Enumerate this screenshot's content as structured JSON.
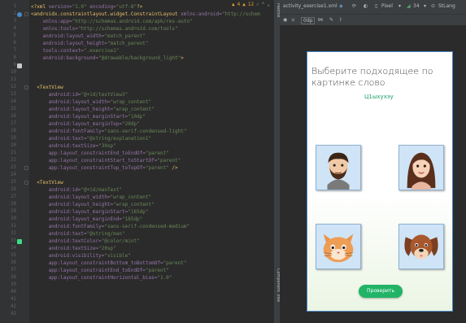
{
  "editor": {
    "status": {
      "warnings": "4",
      "weak_warnings": "12",
      "check_glyph": "✓"
    },
    "line_numbers": [
      "1",
      "2",
      "3",
      "4",
      "5",
      "6",
      "7",
      "8",
      "9",
      "10",
      "11",
      "12",
      "13",
      "14",
      "15",
      "16",
      "17",
      "18",
      "19",
      "20",
      "21",
      "22",
      "23",
      "24",
      "25",
      "26",
      "27",
      "28",
      "29",
      "30",
      "31",
      "32",
      "33",
      "34",
      "35",
      "36",
      "37",
      "38",
      "39",
      "40",
      "41",
      "42",
      "43"
    ],
    "lines": [
      [
        {
          "c": "tg",
          "t": "<?xml "
        },
        {
          "c": "at",
          "t": "version="
        },
        {
          "c": "sv",
          "t": "\"1.0\" "
        },
        {
          "c": "at",
          "t": "encoding="
        },
        {
          "c": "sv",
          "t": "\"utf-8\""
        },
        {
          "c": "tg",
          "t": "?>"
        }
      ],
      [
        {
          "c": "tg",
          "t": "<androidx.constraintlayout.widget.ConstraintLayout "
        },
        {
          "c": "at",
          "t": "xmlns:android="
        },
        {
          "c": "sv",
          "t": "\"http://schem"
        }
      ],
      [
        {
          "c": "pl",
          "t": "    "
        },
        {
          "c": "at",
          "t": "xmlns:app="
        },
        {
          "c": "sv",
          "t": "\"http://schemas.android.com/apk/res-auto\""
        }
      ],
      [
        {
          "c": "pl",
          "t": "    "
        },
        {
          "c": "at",
          "t": "xmlns:tools="
        },
        {
          "c": "sv",
          "t": "\"http://schemas.android.com/tools\""
        }
      ],
      [
        {
          "c": "pl",
          "t": "    "
        },
        {
          "c": "at",
          "t": "android:layout_width="
        },
        {
          "c": "sv",
          "t": "\"match_parent\""
        }
      ],
      [
        {
          "c": "pl",
          "t": "    "
        },
        {
          "c": "at",
          "t": "android:layout_height="
        },
        {
          "c": "sv",
          "t": "\"match_parent\""
        }
      ],
      [
        {
          "c": "pl",
          "t": "    "
        },
        {
          "c": "at",
          "t": "tools:context="
        },
        {
          "c": "sv",
          "t": "\".exercise1\""
        }
      ],
      [
        {
          "c": "pl",
          "t": "    "
        },
        {
          "c": "at",
          "t": "android:background="
        },
        {
          "c": "sv",
          "t": "\"@drawable/background_light\""
        },
        {
          "c": "tg",
          "t": ">"
        }
      ],
      [],
      [],
      [],
      [
        {
          "c": "pl",
          "t": "  "
        },
        {
          "c": "tg",
          "t": "<TextView"
        }
      ],
      [
        {
          "c": "pl",
          "t": "      "
        },
        {
          "c": "at",
          "t": "android:id="
        },
        {
          "c": "sv",
          "t": "\"@+id/textView3\""
        }
      ],
      [
        {
          "c": "pl",
          "t": "      "
        },
        {
          "c": "at",
          "t": "android:layout_width="
        },
        {
          "c": "sv",
          "t": "\"wrap_content\""
        }
      ],
      [
        {
          "c": "pl",
          "t": "      "
        },
        {
          "c": "at",
          "t": "android:layout_height="
        },
        {
          "c": "sv",
          "t": "\"wrap_content\""
        }
      ],
      [
        {
          "c": "pl",
          "t": "      "
        },
        {
          "c": "at",
          "t": "android:layout_marginStart="
        },
        {
          "c": "sv",
          "t": "\"10dp\""
        }
      ],
      [
        {
          "c": "pl",
          "t": "      "
        },
        {
          "c": "at",
          "t": "android:layout_marginTop="
        },
        {
          "c": "sv",
          "t": "\"20dp\""
        }
      ],
      [
        {
          "c": "pl",
          "t": "      "
        },
        {
          "c": "at",
          "t": "android:fontFamily="
        },
        {
          "c": "sv",
          "t": "\"sans-serif-condensed-light\""
        }
      ],
      [
        {
          "c": "pl",
          "t": "      "
        },
        {
          "c": "at",
          "t": "android:text="
        },
        {
          "c": "sv",
          "t": "\"@string/explanation1\""
        }
      ],
      [
        {
          "c": "pl",
          "t": "      "
        },
        {
          "c": "at",
          "t": "android:textSize="
        },
        {
          "c": "sv",
          "t": "\"30sp\""
        }
      ],
      [
        {
          "c": "pl",
          "t": "      "
        },
        {
          "c": "at",
          "t": "app:layout_constraintEnd_toEndOf="
        },
        {
          "c": "sv",
          "t": "\"parent\""
        }
      ],
      [
        {
          "c": "pl",
          "t": "      "
        },
        {
          "c": "at",
          "t": "app:layout_constraintStart_toStartOf="
        },
        {
          "c": "sv",
          "t": "\"parent\""
        }
      ],
      [
        {
          "c": "pl",
          "t": "      "
        },
        {
          "c": "at",
          "t": "app:layout_constraintTop_toTopOf="
        },
        {
          "c": "sv",
          "t": "\"parent\" "
        },
        {
          "c": "tg",
          "t": "/>"
        }
      ],
      [],
      [
        {
          "c": "pl",
          "t": "  "
        },
        {
          "c": "tg",
          "t": "<TextView"
        }
      ],
      [
        {
          "c": "pl",
          "t": "      "
        },
        {
          "c": "at",
          "t": "android:id="
        },
        {
          "c": "sv",
          "t": "\"@+id/manText\""
        }
      ],
      [
        {
          "c": "pl",
          "t": "      "
        },
        {
          "c": "at",
          "t": "android:layout_width="
        },
        {
          "c": "sv",
          "t": "\"wrap_content\""
        }
      ],
      [
        {
          "c": "pl",
          "t": "      "
        },
        {
          "c": "at",
          "t": "android:layout_height="
        },
        {
          "c": "sv",
          "t": "\"wrap_content\""
        }
      ],
      [
        {
          "c": "pl",
          "t": "      "
        },
        {
          "c": "at",
          "t": "android:layout_marginStart="
        },
        {
          "c": "sv",
          "t": "\"165dp\""
        }
      ],
      [
        {
          "c": "pl",
          "t": "      "
        },
        {
          "c": "at",
          "t": "android:layout_marginEnd="
        },
        {
          "c": "sv",
          "t": "\"165dp\""
        }
      ],
      [
        {
          "c": "pl",
          "t": "      "
        },
        {
          "c": "at",
          "t": "android:fontFamily="
        },
        {
          "c": "sv",
          "t": "\"sans-serif-condensed-medium\""
        }
      ],
      [
        {
          "c": "pl",
          "t": "      "
        },
        {
          "c": "at",
          "t": "android:text="
        },
        {
          "c": "sv",
          "t": "\"@string/man\""
        }
      ],
      [
        {
          "c": "pl",
          "t": "      "
        },
        {
          "c": "at",
          "t": "android:textColor="
        },
        {
          "c": "sv",
          "t": "\"@color/mint\""
        }
      ],
      [
        {
          "c": "pl",
          "t": "      "
        },
        {
          "c": "at",
          "t": "android:textSize="
        },
        {
          "c": "sv",
          "t": "\"20sp\""
        }
      ],
      [
        {
          "c": "pl",
          "t": "      "
        },
        {
          "c": "at",
          "t": "android:visibility="
        },
        {
          "c": "sv",
          "t": "\"visible\""
        }
      ],
      [
        {
          "c": "pl",
          "t": "      "
        },
        {
          "c": "at",
          "t": "app:layout_constraintBottom_toBottomOf="
        },
        {
          "c": "sv",
          "t": "\"parent\""
        }
      ],
      [
        {
          "c": "pl",
          "t": "      "
        },
        {
          "c": "at",
          "t": "app:layout_constraintEnd_toEndOf="
        },
        {
          "c": "sv",
          "t": "\"parent\""
        }
      ],
      [
        {
          "c": "pl",
          "t": "      "
        },
        {
          "c": "at",
          "t": "app:layout_constraintHorizontal_bias="
        },
        {
          "c": "sv",
          "t": "\"1.0\""
        }
      ]
    ]
  },
  "side_strip": {
    "top_label": "Palette",
    "bottom_label": "Component Tree"
  },
  "design": {
    "file_tab": "activity_exercise1.xml",
    "device": "Pixel",
    "api": "34",
    "theme": "StLang",
    "dp_value": "0dp",
    "colors": {
      "accent": "#21b467",
      "word": "#1ca26a",
      "frame": "#4a88c7"
    }
  },
  "phone": {
    "title": "Выберите подходящее по картинке слово",
    "word": "Ц1ыхухэу",
    "images": [
      {
        "name": "man-face",
        "icon": "man-face-icon"
      },
      {
        "name": "woman-face",
        "icon": "woman-face-icon"
      },
      {
        "name": "cat-face",
        "icon": "cat-face-icon"
      },
      {
        "name": "dog-face",
        "icon": "dog-face-icon"
      }
    ],
    "check_button": "Проверить"
  }
}
